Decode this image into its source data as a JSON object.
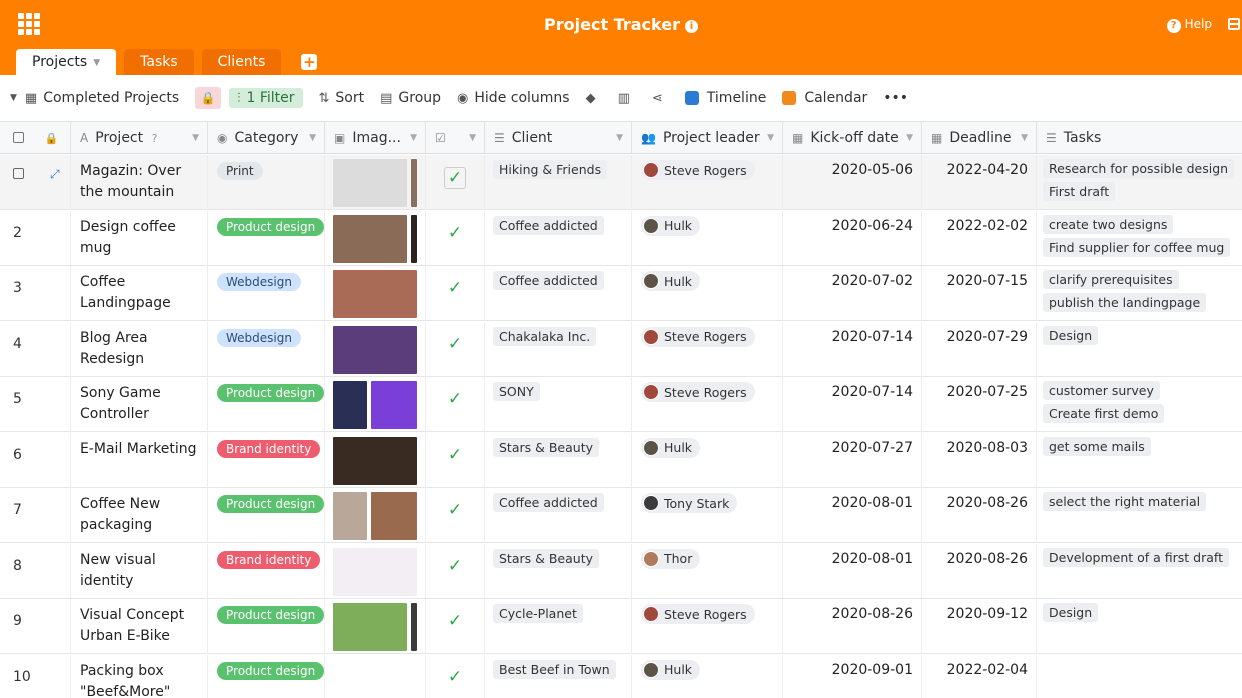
{
  "app": {
    "title": "Project Tracker",
    "help_label": "Help"
  },
  "tabs": [
    {
      "label": "Projects"
    },
    {
      "label": "Tasks"
    },
    {
      "label": "Clients"
    }
  ],
  "toolbar": {
    "view_name": "Completed Projects",
    "filter_label": "1 Filter",
    "sort_label": "Sort",
    "group_label": "Group",
    "hide_columns_label": "Hide columns",
    "timeline_label": "Timeline",
    "calendar_label": "Calendar",
    "more_label": "•••"
  },
  "columns": {
    "project": "Project",
    "category": "Category",
    "images": "Imag...",
    "client": "Client",
    "project_leader": "Project leader",
    "kickoff": "Kick-off date",
    "deadline": "Deadline",
    "tasks": "Tasks"
  },
  "colors": {
    "brand": "#ff8000",
    "print": "#e3e7ec",
    "product_design": "#5ac26f",
    "webdesign": "#cfe2fb",
    "brand_identity": "#ee5d6e"
  },
  "rows": [
    {
      "num": "",
      "project": "Magazin: Over the mountain",
      "category": "Print",
      "cat_color": "#e3e7ec",
      "cat_text": "#333333",
      "images": [
        "#dcdcdc",
        "#8a7060"
      ],
      "client": "Hiking & Friends",
      "leader": "Steve Rogers",
      "avatar": "#a0483c",
      "kickoff": "2020-05-06",
      "deadline": "2022-04-20",
      "tasks": [
        "Research for possible design",
        "First draft"
      ]
    },
    {
      "num": "2",
      "project": "Design coffee mug",
      "category": "Product design",
      "cat_color": "#5ac26f",
      "cat_text": "#ffffff",
      "images": [
        "#8a6b57",
        "#2d2421"
      ],
      "client": "Coffee addicted",
      "leader": "Hulk",
      "avatar": "#5b5447",
      "kickoff": "2020-06-24",
      "deadline": "2022-02-02",
      "tasks": [
        "create two designs",
        "Find supplier for coffee mug"
      ]
    },
    {
      "num": "3",
      "project": "Coffee Landingpage",
      "category": "Webdesign",
      "cat_color": "#cfe2fb",
      "cat_text": "#2b4e7a",
      "images": [
        "#a96b56"
      ],
      "client": "Coffee addicted",
      "leader": "Hulk",
      "avatar": "#5b5447",
      "kickoff": "2020-07-02",
      "deadline": "2020-07-15",
      "tasks": [
        "clarify prerequisites",
        "publish the landingpage"
      ]
    },
    {
      "num": "4",
      "project": "Blog Area Redesign",
      "category": "Webdesign",
      "cat_color": "#cfe2fb",
      "cat_text": "#2b4e7a",
      "images": [
        "#5a3d7a"
      ],
      "client": "Chakalaka Inc.",
      "leader": "Steve Rogers",
      "avatar": "#a0483c",
      "kickoff": "2020-07-14",
      "deadline": "2020-07-29",
      "tasks": [
        "Design"
      ]
    },
    {
      "num": "5",
      "project": "Sony Game Controller",
      "category": "Product design",
      "cat_color": "#5ac26f",
      "cat_text": "#ffffff",
      "images": [
        "#2a2f55",
        "#7a3fd6"
      ],
      "client": "SONY",
      "leader": "Steve Rogers",
      "avatar": "#a0483c",
      "kickoff": "2020-07-14",
      "deadline": "2020-07-25",
      "tasks": [
        "customer survey",
        "Create first demo"
      ]
    },
    {
      "num": "6",
      "project": "E-Mail Marketing",
      "category": "Brand identity",
      "cat_color": "#ee5d6e",
      "cat_text": "#ffffff",
      "images": [
        "#3a2b22"
      ],
      "client": "Stars & Beauty",
      "leader": "Hulk",
      "avatar": "#5b5447",
      "kickoff": "2020-07-27",
      "deadline": "2020-08-03",
      "tasks": [
        "get some mails"
      ]
    },
    {
      "num": "7",
      "project": "Coffee New packaging",
      "category": "Product design",
      "cat_color": "#5ac26f",
      "cat_text": "#ffffff",
      "images": [
        "#b9a89a",
        "#9a6a4e"
      ],
      "client": "Coffee addicted",
      "leader": "Tony Stark",
      "avatar": "#3b3b3b",
      "kickoff": "2020-08-01",
      "deadline": "2020-08-26",
      "tasks": [
        "select the right material"
      ]
    },
    {
      "num": "8",
      "project": "New visual identity",
      "category": "Brand identity",
      "cat_color": "#ee5d6e",
      "cat_text": "#ffffff",
      "images": [
        "#f3eef4"
      ],
      "client": "Stars & Beauty",
      "leader": "Thor",
      "avatar": "#b07a5c",
      "kickoff": "2020-08-01",
      "deadline": "2020-08-26",
      "tasks": [
        "Development of a first draft"
      ]
    },
    {
      "num": "9",
      "project": "Visual Concept Urban E-Bike",
      "category": "Product design",
      "cat_color": "#5ac26f",
      "cat_text": "#ffffff",
      "images": [
        "#7fae5a",
        "#3b3b3b"
      ],
      "client": "Cycle-Planet",
      "leader": "Steve Rogers",
      "avatar": "#a0483c",
      "kickoff": "2020-08-26",
      "deadline": "2020-09-12",
      "tasks": [
        "Design"
      ]
    },
    {
      "num": "10",
      "project": "Packing box \"Beef&More\"",
      "category": "Product design",
      "cat_color": "#5ac26f",
      "cat_text": "#ffffff",
      "images": [],
      "client": "Best Beef in Town",
      "leader": "Hulk",
      "avatar": "#5b5447",
      "kickoff": "2020-09-01",
      "deadline": "2022-02-04",
      "tasks": []
    }
  ]
}
